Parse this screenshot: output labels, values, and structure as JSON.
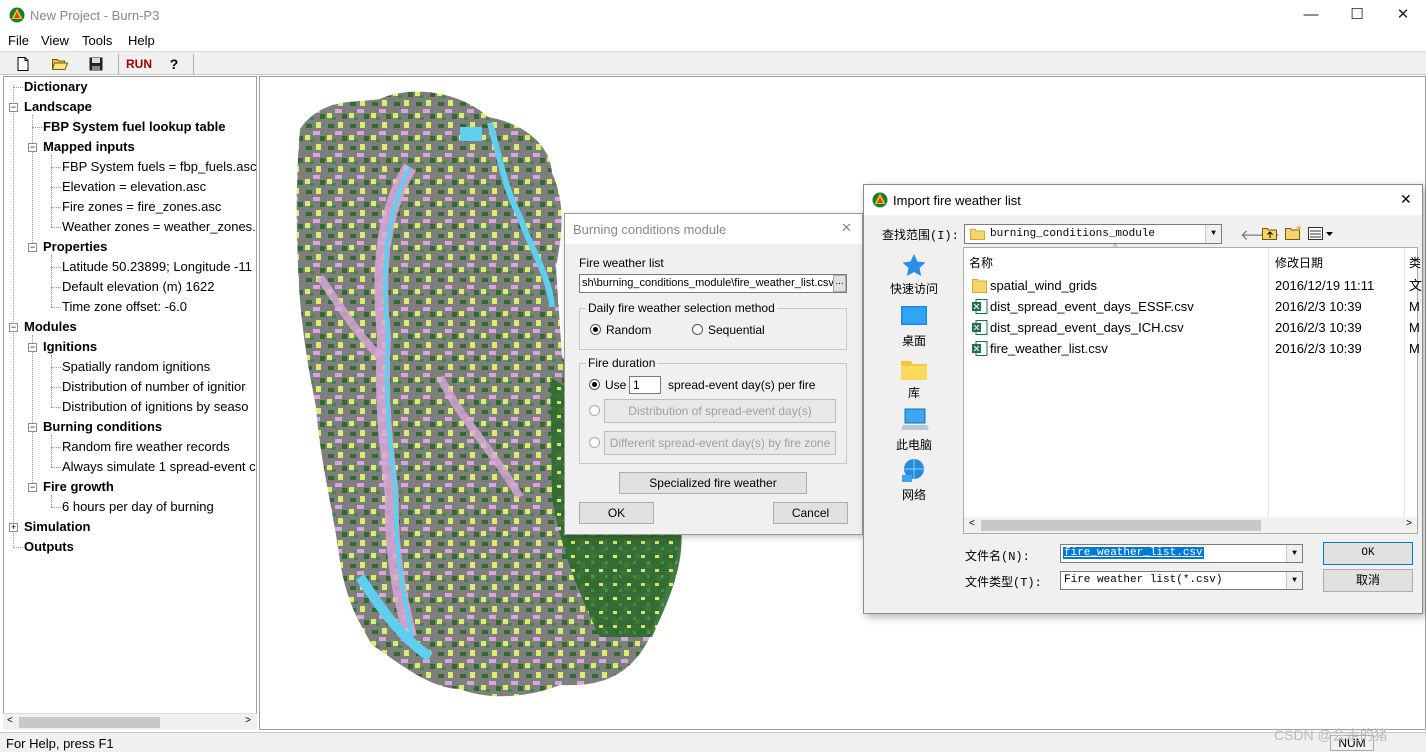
{
  "window": {
    "title": "New Project - Burn-P3",
    "minimize": "—",
    "maximize": "☐",
    "close": "✕"
  },
  "menu": [
    "File",
    "View",
    "Tools",
    "Help"
  ],
  "toolbar": {
    "run": "RUN",
    "help": "?"
  },
  "tree": [
    {
      "label": "Dictionary",
      "bold": true
    },
    {
      "label": "Landscape",
      "bold": true
    },
    {
      "label": "FBP System fuel lookup table",
      "bold": true
    },
    {
      "label": "Mapped inputs",
      "bold": true
    },
    {
      "label": "FBP System fuels = fbp_fuels.asc",
      "bold": false
    },
    {
      "label": "Elevation = elevation.asc",
      "bold": false
    },
    {
      "label": "Fire zones = fire_zones.asc",
      "bold": false
    },
    {
      "label": "Weather zones = weather_zones.",
      "bold": false
    },
    {
      "label": "Properties",
      "bold": true
    },
    {
      "label": "Latitude 50.23899; Longitude -11",
      "bold": false
    },
    {
      "label": "Default elevation (m) 1622",
      "bold": false
    },
    {
      "label": "Time zone offset: -6.0",
      "bold": false
    },
    {
      "label": "Modules",
      "bold": true
    },
    {
      "label": "Ignitions",
      "bold": true
    },
    {
      "label": "Spatially random ignitions",
      "bold": false
    },
    {
      "label": "Distribution of number of ignitior",
      "bold": false
    },
    {
      "label": "Distribution of ignitions by seaso",
      "bold": false
    },
    {
      "label": "Burning conditions",
      "bold": true
    },
    {
      "label": "Random fire weather records",
      "bold": false
    },
    {
      "label": "Always simulate 1 spread-event c",
      "bold": false
    },
    {
      "label": "Fire growth",
      "bold": true
    },
    {
      "label": "6 hours per day of burning",
      "bold": false
    },
    {
      "label": "Simulation",
      "bold": true
    },
    {
      "label": "Outputs",
      "bold": true
    }
  ],
  "status": {
    "help": "For Help, press F1",
    "num": "NUM"
  },
  "watermark": "CSDN @会走的猪",
  "burning_dialog": {
    "title": "Burning conditions module",
    "close": "✕",
    "fire_weather_list_label": "Fire weather list",
    "fire_weather_list_value": "sh\\burning_conditions_module\\fire_weather_list.csv",
    "browse": "...",
    "selection_group": "Daily fire weather selection method",
    "random": "Random",
    "sequential": "Sequential",
    "duration_group": "Fire duration",
    "use": "Use",
    "use_value": "1",
    "per_fire": "spread-event day(s) per fire",
    "distribution_btn": "Distribution of spread-event day(s)",
    "different_btn": "Different spread-event day(s) by fire zone",
    "specialized_btn": "Specialized fire weather",
    "ok": "OK",
    "cancel": "Cancel"
  },
  "import_dialog": {
    "title": "Import fire weather list",
    "close": "✕",
    "look_in_label": "查找范围(I):",
    "look_in_value": "burning_conditions_module",
    "places": [
      "快速访问",
      "桌面",
      "库",
      "此电脑",
      "网络"
    ],
    "columns": {
      "name": "名称",
      "date": "修改日期",
      "extra": "类"
    },
    "files": [
      {
        "name": "spatial_wind_grids",
        "date": "2016/12/19 11:11",
        "type": "folder",
        "extra": "文"
      },
      {
        "name": "dist_spread_event_days_ESSF.csv",
        "date": "2016/2/3 10:39",
        "type": "csv",
        "extra": "M"
      },
      {
        "name": "dist_spread_event_days_ICH.csv",
        "date": "2016/2/3 10:39",
        "type": "csv",
        "extra": "M"
      },
      {
        "name": "fire_weather_list.csv",
        "date": "2016/2/3 10:39",
        "type": "csv",
        "extra": "M"
      }
    ],
    "filename_label": "文件名(N):",
    "filename_value": "fire_weather_list.csv",
    "filetype_label": "文件类型(T):",
    "filetype_value": "Fire weather list(*.csv)",
    "ok": "OK",
    "cancel": "取消"
  },
  "colors": {
    "accent": "#0078d7",
    "map_gray": "#808080",
    "map_green": "#2e6b2e",
    "map_yellow": "#d9ef6b",
    "map_pink": "#d8a6d8",
    "map_water": "#5fcff0"
  }
}
